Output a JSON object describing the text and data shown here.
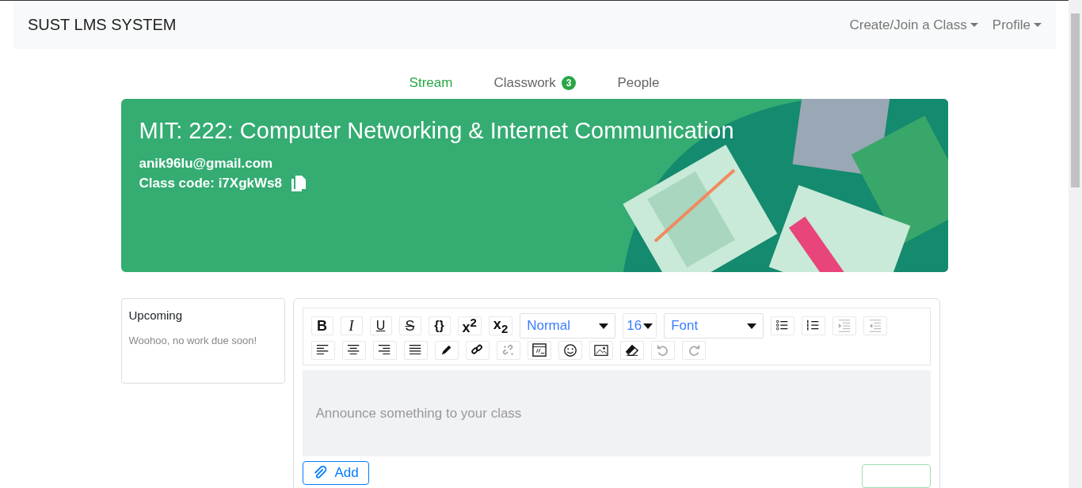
{
  "navbar": {
    "brand": "SUST LMS SYSTEM",
    "menus": [
      {
        "label": "Create/Join a Class"
      },
      {
        "label": "Profile"
      }
    ]
  },
  "tabs": [
    {
      "label": "Stream",
      "selected": true
    },
    {
      "label": "Classwork",
      "selected": false,
      "badge": "3"
    },
    {
      "label": "People",
      "selected": false
    }
  ],
  "banner": {
    "title": "MIT: 222: Computer Networking & Internet Communication",
    "email": "anik96lu@gmail.com",
    "class_code": "Class code: i7XgkWs8"
  },
  "upcoming": {
    "title": "Upcoming",
    "message": "Woohoo, no work due soon!"
  },
  "editor": {
    "toolbar": [
      [
        {
          "kind": "bold",
          "label": "B",
          "disabled": false
        },
        {
          "kind": "italic",
          "label": "I",
          "disabled": false
        },
        {
          "kind": "underline",
          "label": "U",
          "disabled": false
        },
        {
          "kind": "strike",
          "label": "S",
          "disabled": false
        },
        {
          "kind": "code",
          "label": "{}",
          "disabled": false
        },
        {
          "kind": "sup",
          "label": "x$^{2}$",
          "disabled": false
        },
        {
          "kind": "sub",
          "label": "x$_{2}$",
          "disabled": false
        },
        {
          "kind": "select",
          "label": "Normal"
        },
        {
          "kind": "size",
          "label": "16"
        },
        {
          "kind": "select",
          "label": "Font"
        },
        {
          "kind": "bullets",
          "disabled": false
        },
        {
          "kind": "numbers",
          "disabled": false
        },
        {
          "kind": "indent",
          "disabled": true
        },
        {
          "kind": "outdent",
          "disabled": true
        }
      ],
      [
        {
          "kind": "alignleft",
          "disabled": false
        },
        {
          "kind": "aligncenter",
          "disabled": false
        },
        {
          "kind": "alignright",
          "disabled": false
        },
        {
          "kind": "justify",
          "disabled": false
        },
        {
          "kind": "pen",
          "disabled": false
        },
        {
          "kind": "link",
          "disabled": false
        },
        {
          "kind": "unlink",
          "disabled": true
        },
        {
          "kind": "embed",
          "disabled": false
        },
        {
          "kind": "emoji",
          "disabled": false
        },
        {
          "kind": "image",
          "disabled": false
        },
        {
          "kind": "eraser",
          "disabled": false
        },
        {
          "kind": "undo",
          "disabled": true
        },
        {
          "kind": "redo",
          "disabled": true
        }
      ]
    ],
    "placeholder": "Announce something to your class",
    "add_button": "Add"
  }
}
